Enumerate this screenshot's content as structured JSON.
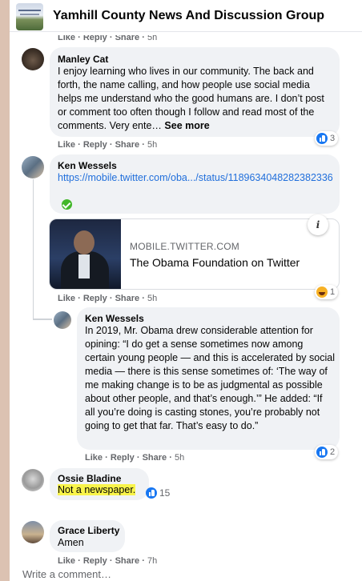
{
  "header": {
    "title": "Yamhill County News And Discussion Group"
  },
  "action_labels": {
    "like": "Like",
    "reply": "Reply",
    "share": "Share",
    "sep": "·"
  },
  "top_partial": {
    "time": "5h"
  },
  "comments": [
    {
      "author": "Manley Cat",
      "text": "I enjoy learning who lives in our community. The back and forth, the name calling, and how people use social media helps me understand who the good humans are. I don’t post or comment too often though I follow and read most of the comments. Very ente…",
      "see_more": "See more",
      "time": "5h",
      "reactions": {
        "type": "like-icon",
        "count": "3"
      }
    },
    {
      "author": "Ken Wessels",
      "link": "https://mobile.twitter.com/oba.../status/1189634048282382336",
      "card": {
        "domain": "MOBILE.TWITTER.COM",
        "title": "The Obama Foundation on Twitter"
      },
      "time": "5h",
      "reactions": {
        "type": "haha-icon",
        "count": "1"
      }
    },
    {
      "author": "Ken Wessels",
      "text": "In 2019, Mr. Obama drew considerable attention for opining: “I do get a sense sometimes now among certain young people — and this is accelerated by social media — there is this sense sometimes of: ‘The way of me making change is to be as judgmental as possible about other people, and that’s enough.’” He added: “If all you’re doing is casting stones, you’re probably not going to get that far. That’s easy to do.”",
      "time": "5h",
      "reactions": {
        "type": "like-icon",
        "count": "2"
      }
    },
    {
      "author": "Ossie Bladine",
      "text": "Not a newspaper.",
      "reactions": {
        "type": "like-icon",
        "count": "15"
      }
    },
    {
      "author": "Grace Liberty",
      "text": "Amen",
      "time": "7h"
    }
  ],
  "composer": {
    "placeholder": "Write a comment…"
  },
  "colors": {
    "link": "#216fdb",
    "bubble": "#f0f2f5",
    "highlight": "#f9f44a",
    "like_blue": "#1877f2"
  }
}
